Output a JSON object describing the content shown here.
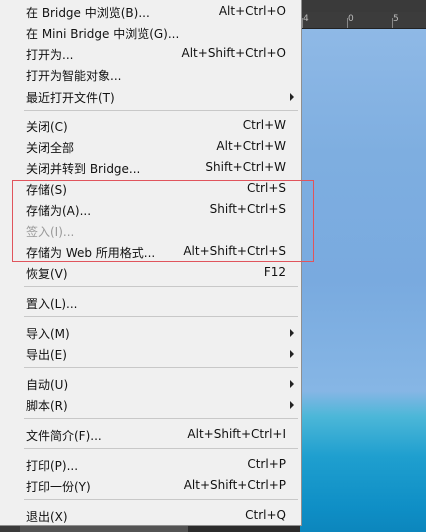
{
  "ruler": {
    "marks": [
      "4",
      "0",
      "5"
    ]
  },
  "menu": {
    "items": [
      {
        "label": "在 Bridge 中浏览(B)...",
        "shortcut": "Alt+Ctrl+O"
      },
      {
        "label": "在 Mini Bridge 中浏览(G)...",
        "shortcut": ""
      },
      {
        "label": "打开为...",
        "shortcut": "Alt+Shift+Ctrl+O"
      },
      {
        "label": "打开为智能对象...",
        "shortcut": ""
      },
      {
        "label": "最近打开文件(T)",
        "shortcut": "",
        "submenu": true
      },
      {
        "label": "关闭(C)",
        "shortcut": "Ctrl+W"
      },
      {
        "label": "关闭全部",
        "shortcut": "Alt+Ctrl+W"
      },
      {
        "label": "关闭并转到 Bridge...",
        "shortcut": "Shift+Ctrl+W"
      },
      {
        "label": "存储(S)",
        "shortcut": "Ctrl+S"
      },
      {
        "label": "存储为(A)...",
        "shortcut": "Shift+Ctrl+S"
      },
      {
        "label": "签入(I)...",
        "shortcut": "",
        "disabled": true
      },
      {
        "label": "存储为 Web 所用格式...",
        "shortcut": "Alt+Shift+Ctrl+S"
      },
      {
        "label": "恢复(V)",
        "shortcut": "F12"
      },
      {
        "label": "置入(L)...",
        "shortcut": ""
      },
      {
        "label": "导入(M)",
        "shortcut": "",
        "submenu": true
      },
      {
        "label": "导出(E)",
        "shortcut": "",
        "submenu": true
      },
      {
        "label": "自动(U)",
        "shortcut": "",
        "submenu": true
      },
      {
        "label": "脚本(R)",
        "shortcut": "",
        "submenu": true
      },
      {
        "label": "文件简介(F)...",
        "shortcut": "Alt+Shift+Ctrl+I"
      },
      {
        "label": "打印(P)...",
        "shortcut": "Ctrl+P"
      },
      {
        "label": "打印一份(Y)",
        "shortcut": "Alt+Shift+Ctrl+P"
      },
      {
        "label": "退出(X)",
        "shortcut": "Ctrl+Q"
      }
    ]
  },
  "colors": {
    "highlight_border": "#e0545c",
    "menu_bg": "#f0f0f0"
  }
}
